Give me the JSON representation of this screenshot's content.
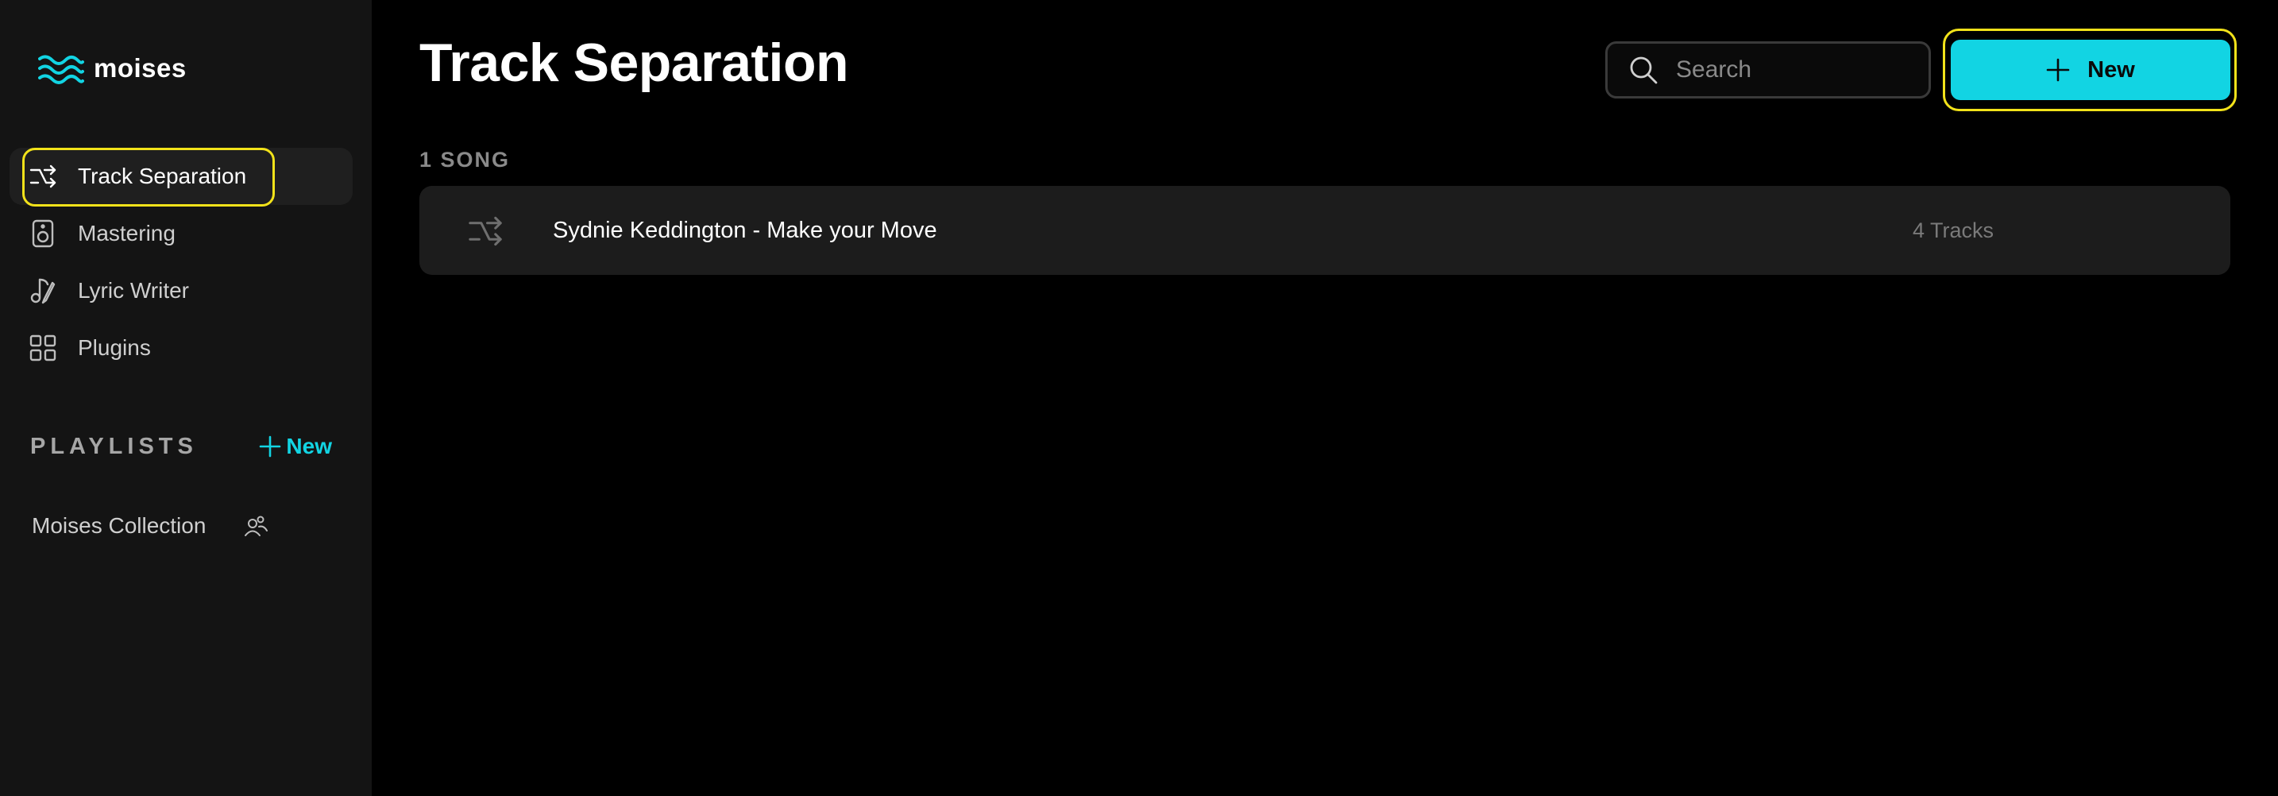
{
  "app": {
    "brand": "moises"
  },
  "sidebar": {
    "items": [
      {
        "label": "Track Separation",
        "icon": "track-separation-icon",
        "active": true
      },
      {
        "label": "Mastering",
        "icon": "mastering-speaker-icon",
        "active": false
      },
      {
        "label": "Lyric Writer",
        "icon": "lyric-pen-icon",
        "active": false
      },
      {
        "label": "Plugins",
        "icon": "grid-icon",
        "active": false
      }
    ],
    "playlists_title": "PLAYLISTS",
    "playlists_new_label": "New",
    "playlists": [
      {
        "label": "Moises Collection",
        "icon": "shared-users-icon"
      }
    ]
  },
  "main": {
    "title": "Track Separation",
    "search": {
      "placeholder": "Search",
      "value": ""
    },
    "new_button_label": "New",
    "song_count_label": "1 SONG",
    "songs": [
      {
        "title": "Sydnie Keddington - Make your Move",
        "tracks": "4 Tracks"
      }
    ]
  },
  "colors": {
    "accent": "#12d4e3",
    "highlight": "#f2e21a",
    "sidebar_bg": "#141414",
    "main_bg": "#000000",
    "row_bg": "#1c1c1c"
  }
}
